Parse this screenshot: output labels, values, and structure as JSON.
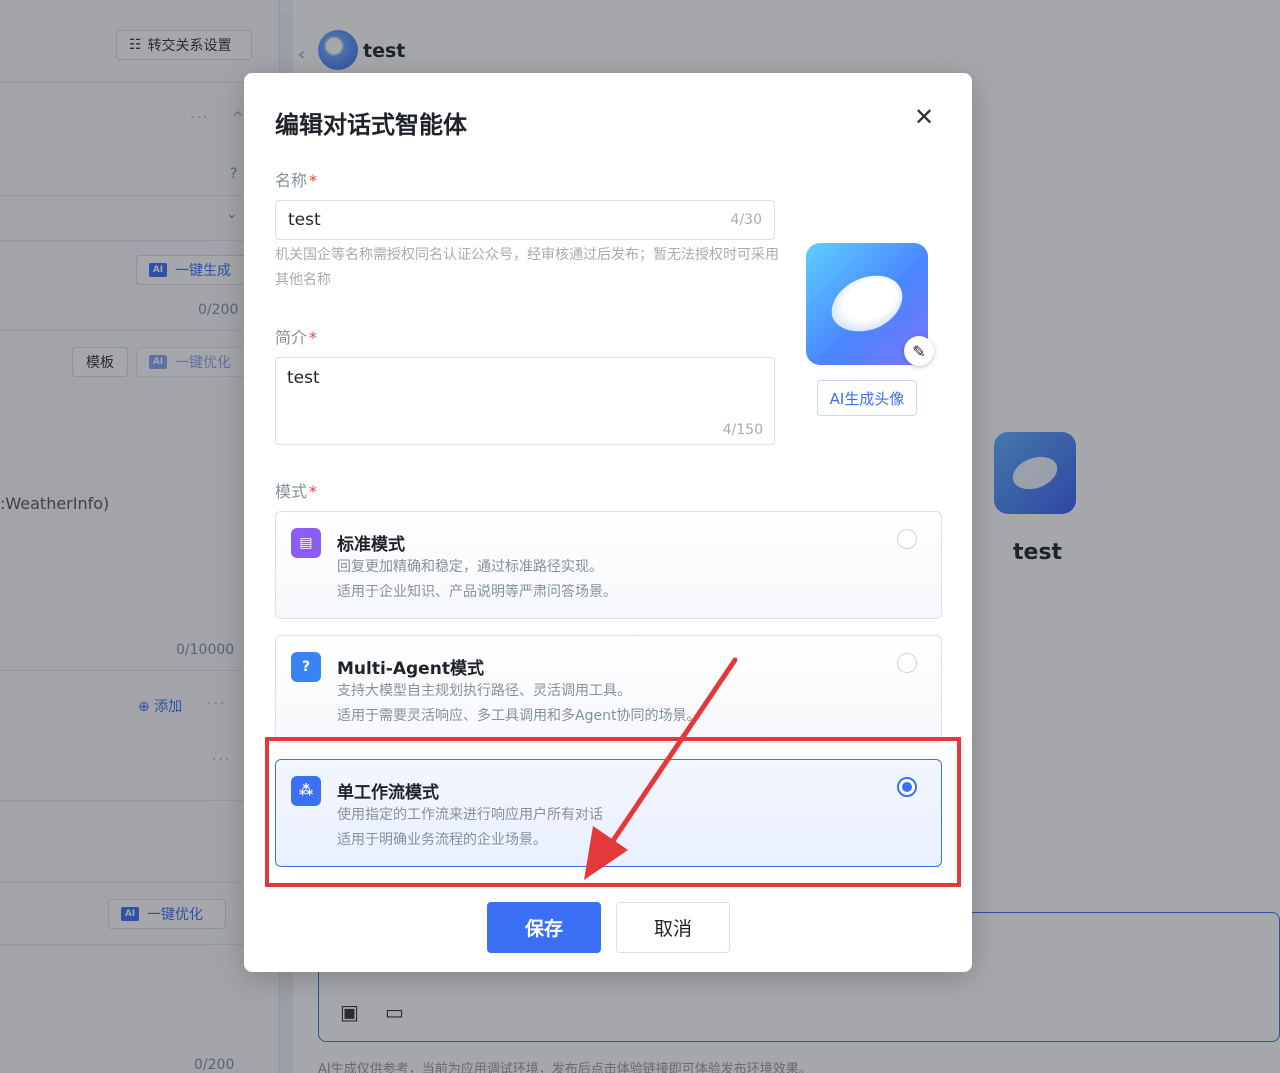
{
  "background": {
    "transfer_button": "转交关系设置",
    "ai_generate": "一键生成",
    "ai_optimize": "一键优化",
    "ai_badge": "AI",
    "counter_a": "0/200",
    "counter_b": "0/10000",
    "counter_c": "0/200",
    "template_label": "模板",
    "weather_text": ":WeatherInfo)",
    "add_label": "添加",
    "agent_name": "test",
    "footer_note": "AI生成仅供参考，当前为应用调试环境，发布后点击体验链接即可体验发布环境效果。"
  },
  "modal": {
    "title": "编辑对话式智能体",
    "close_icon": "close-icon",
    "name_label": "名称",
    "name_value": "test",
    "name_counter": "4/30",
    "name_hint": "机关国企等名称需授权同名认证公众号，经审核通过后发布；暂无法授权时可采用其他名称",
    "intro_label": "简介",
    "intro_value": "test",
    "intro_counter": "4/150",
    "ai_avatar_button": "AI生成头像",
    "mode_label": "模式",
    "modes": [
      {
        "title": "标准模式",
        "desc1": "回复更加精确和稳定，通过标准路径实现。",
        "desc2": "适用于企业知识、产品说明等严肃问答场景。",
        "selected": false,
        "icon": "document-icon",
        "icon_color": "#8b5cf6"
      },
      {
        "title": "Multi-Agent模式",
        "desc1": "支持大模型自主规划执行路径、灵活调用工具。",
        "desc2": "适用于需要灵活响应、多工具调用和多Agent协同的场景。",
        "selected": false,
        "icon": "question-icon",
        "icon_color": "#3b82f6"
      },
      {
        "title": "单工作流模式",
        "desc1": "使用指定的工作流来进行响应用户所有对话",
        "desc2": "适用于明确业务流程的企业场景。",
        "selected": true,
        "icon": "workflow-icon",
        "icon_color": "#3b6ff4"
      }
    ],
    "save_label": "保存",
    "cancel_label": "取消"
  },
  "colors": {
    "accent": "#3b6ff4",
    "annotation": "#e5383b"
  }
}
